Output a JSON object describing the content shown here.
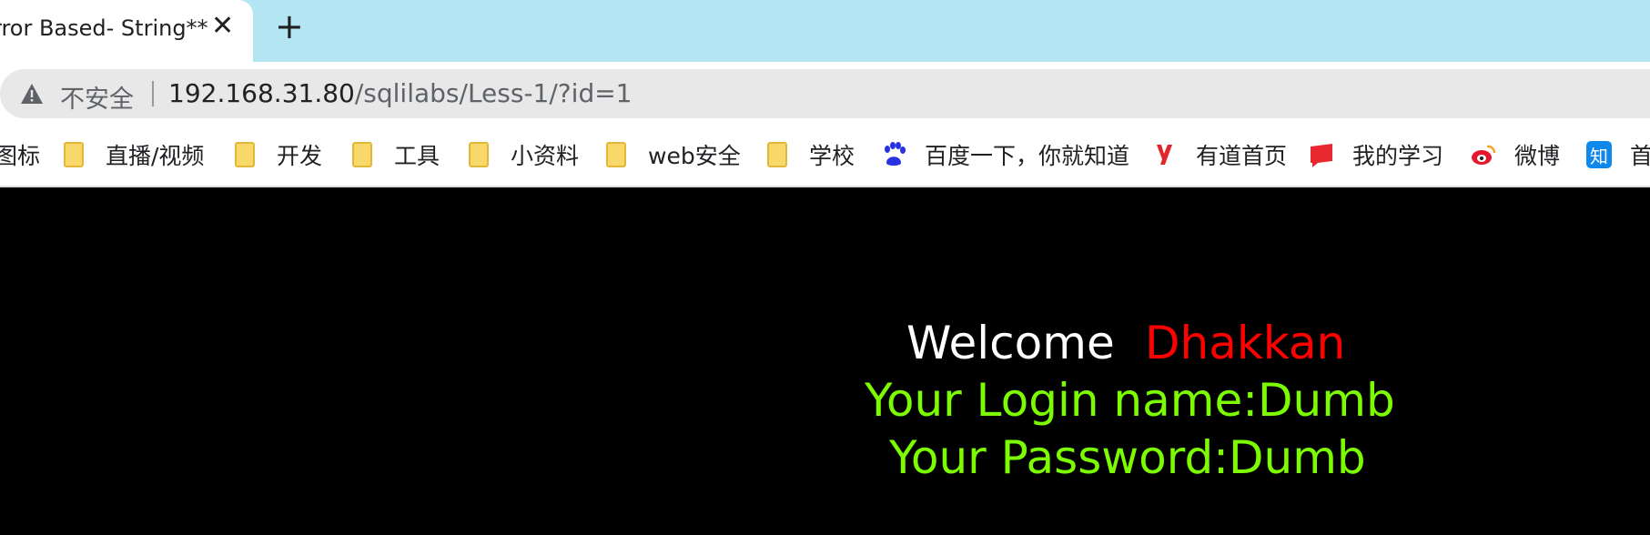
{
  "browser": {
    "tab": {
      "title": "rror Based- String**",
      "close_icon": "close-icon"
    },
    "new_tab_icon": "plus-icon",
    "address": {
      "security_label": "不安全",
      "url_host": "192.168.31.80",
      "url_path": "/sqlilabs/Less-1/?id=1"
    },
    "bookmarks": [
      {
        "label": "图标",
        "icon": "folder-icon"
      },
      {
        "label": "直播/视频",
        "icon": "folder-icon"
      },
      {
        "label": "开发",
        "icon": "folder-icon"
      },
      {
        "label": "工具",
        "icon": "folder-icon"
      },
      {
        "label": "小资料",
        "icon": "folder-icon"
      },
      {
        "label": "web安全",
        "icon": "folder-icon"
      },
      {
        "label": "学校",
        "icon": "folder-icon"
      },
      {
        "label": "百度一下，你就知道",
        "icon": "baidu-paw-icon"
      },
      {
        "label": "有道首页",
        "icon": "youdao-icon"
      },
      {
        "label": "我的学习",
        "icon": "red-book-icon"
      },
      {
        "label": "微博",
        "icon": "weibo-icon"
      },
      {
        "label": "首",
        "icon": "zhihu-icon",
        "icon_text": "知"
      }
    ]
  },
  "page": {
    "welcome": "Welcome",
    "name": "Dhakkan",
    "login": "Your Login name:Dumb",
    "password": "Your Password:Dumb",
    "colors": {
      "background": "#000000",
      "welcome": "#ffffff",
      "name": "#ff0000",
      "info": "#7cfc00"
    }
  }
}
